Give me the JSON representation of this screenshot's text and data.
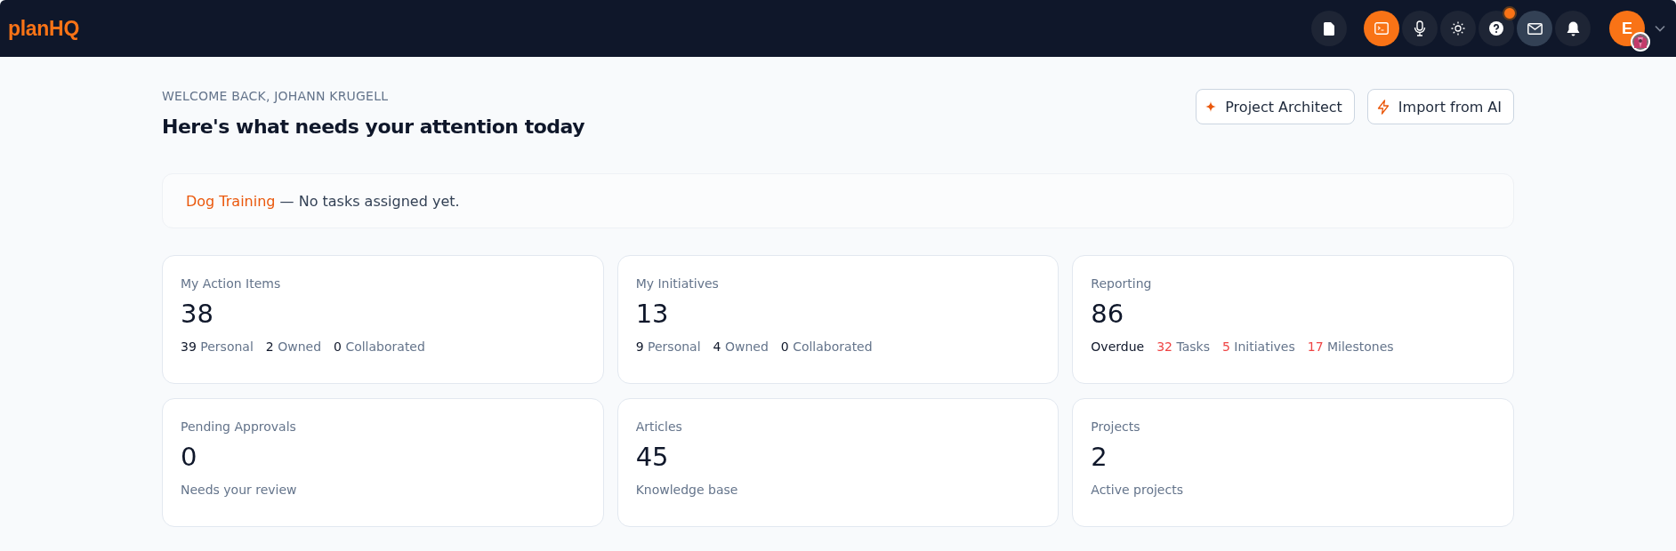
{
  "app": {
    "logo": "planHQ"
  },
  "toolbar": [
    {
      "kind": "file",
      "selected": false,
      "hovered": false,
      "badge": false
    },
    {
      "kind": "terminal",
      "selected": true,
      "hovered": false,
      "badge": false
    },
    {
      "kind": "mic",
      "selected": false,
      "hovered": false,
      "badge": false
    },
    {
      "kind": "sun",
      "selected": false,
      "hovered": false,
      "badge": false
    },
    {
      "kind": "help",
      "selected": false,
      "hovered": false,
      "badge": true
    },
    {
      "kind": "mail",
      "selected": false,
      "hovered": true,
      "badge": false
    },
    {
      "kind": "bell",
      "selected": false,
      "hovered": false,
      "badge": false
    }
  ],
  "user": {
    "initial": "E"
  },
  "welcome": "WELCOME BACK, JOHANN KRUGELL",
  "heading": "Here's what needs your attention today",
  "actions": [
    {
      "kind": "sparkle",
      "label": "Project Architect"
    },
    {
      "kind": "bolt",
      "label": "Import from AI"
    }
  ],
  "notice": {
    "project": "Dog Training",
    "message": "— No tasks assigned yet."
  },
  "cards": [
    {
      "title": "My Action Items",
      "value": "38",
      "stats": [
        {
          "count": "39",
          "label": "Personal",
          "alert": false
        },
        {
          "count": "2",
          "label": "Owned",
          "alert": false
        },
        {
          "count": "0",
          "label": "Collaborated",
          "alert": false
        }
      ]
    },
    {
      "title": "My Initiatives",
      "value": "13",
      "stats": [
        {
          "count": "9",
          "label": "Personal",
          "alert": false
        },
        {
          "count": "4",
          "label": "Owned",
          "alert": false
        },
        {
          "count": "0",
          "label": "Collaborated",
          "alert": false
        }
      ]
    },
    {
      "title": "Reporting",
      "value": "86",
      "prefix": "Overdue",
      "stats": [
        {
          "count": "32",
          "label": "Tasks",
          "alert": true
        },
        {
          "count": "5",
          "label": "Initiatives",
          "alert": true
        },
        {
          "count": "17",
          "label": "Milestones",
          "alert": true
        }
      ]
    },
    {
      "title": "Pending Approvals",
      "value": "0",
      "caption": "Needs your review"
    },
    {
      "title": "Articles",
      "value": "45",
      "caption": "Knowledge base"
    },
    {
      "title": "Projects",
      "value": "2",
      "caption": "Active projects"
    }
  ]
}
